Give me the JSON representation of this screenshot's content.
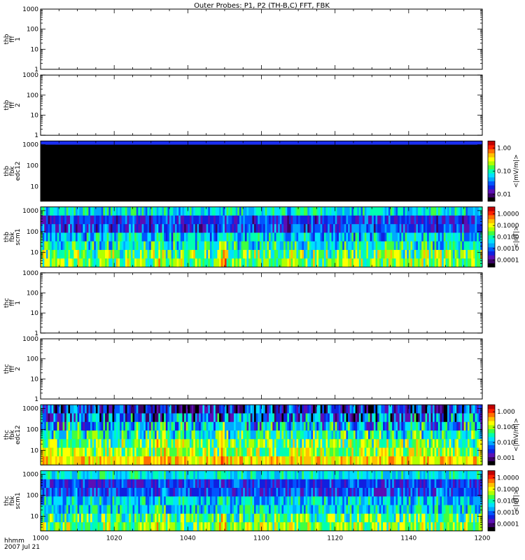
{
  "title": "Outer Probes: P1, P2 (TH-B,C) FFT, FBK",
  "time_axis": {
    "ticks": [
      "1000",
      "1020",
      "1040",
      "1100",
      "1120",
      "1140",
      "1200"
    ],
    "label_units": "hhmm",
    "label_date": "2007 Jul 21"
  },
  "palette": [
    "#000000",
    "#3b0066",
    "#5b0fb5",
    "#1020e0",
    "#0055ff",
    "#00a8ff",
    "#00e0ff",
    "#00ffb0",
    "#40ff40",
    "#b0ff00",
    "#ffff00",
    "#ffc000",
    "#ff7000",
    "#ff2000",
    "#c00000"
  ],
  "chart_data": [
    {
      "id": "thb-fff1",
      "type": "heatmap",
      "ylabel": [
        "thb",
        "fff",
        "1"
      ],
      "yscale": "log",
      "ylim": [
        1,
        1000
      ],
      "yticks": [
        "1",
        "10",
        "100",
        "1000"
      ],
      "empty": true
    },
    {
      "id": "thb-fff2",
      "type": "heatmap",
      "ylabel": [
        "thb",
        "fff",
        "2"
      ],
      "yscale": "log",
      "ylim": [
        1,
        1000
      ],
      "yticks": [
        "1",
        "10",
        "100",
        "1000"
      ],
      "empty": true
    },
    {
      "id": "thb-fbk-edc12",
      "type": "heatmap",
      "ylabel": [
        "thb",
        "fbk",
        "edc12"
      ],
      "yscale": "log",
      "ylim": [
        2,
        1500
      ],
      "yticks": [
        "10",
        "100",
        "1000"
      ],
      "pattern": "black_with_blue_top",
      "colorbar": {
        "label": "<|mV/m|>",
        "ticks": [
          "1.00",
          "0.10",
          "0.01"
        ]
      }
    },
    {
      "id": "thb-fbk-scm1",
      "type": "heatmap",
      "ylabel": [
        "thb",
        "fbk",
        "scm1"
      ],
      "yscale": "log",
      "ylim": [
        2,
        1500
      ],
      "yticks": [
        "10",
        "100",
        "1000"
      ],
      "bands": [
        {
          "base": 6.2,
          "var": 2.0
        },
        {
          "base": 3.2,
          "var": 1.8
        },
        {
          "base": 3.4,
          "var": 2.2
        },
        {
          "base": 5.6,
          "var": 2.4
        },
        {
          "base": 6.5,
          "var": 2.6
        },
        {
          "base": 8.0,
          "var": 3.0
        },
        {
          "base": 8.5,
          "var": 2.5
        }
      ],
      "colorbar": {
        "label": "<|nT|>",
        "ticks": [
          "1.0000",
          "0.1000",
          "0.0100",
          "0.0010",
          "0.0001"
        ]
      }
    },
    {
      "id": "thc-fff1",
      "type": "heatmap",
      "ylabel": [
        "thc",
        "fff",
        "1"
      ],
      "yscale": "log",
      "ylim": [
        1,
        1000
      ],
      "yticks": [
        "1",
        "10",
        "100",
        "1000"
      ],
      "empty": true
    },
    {
      "id": "thc-fff2",
      "type": "heatmap",
      "ylabel": [
        "thc",
        "fff",
        "2"
      ],
      "yscale": "log",
      "ylim": [
        1,
        1000
      ],
      "yticks": [
        "1",
        "10",
        "100",
        "1000"
      ],
      "empty": true
    },
    {
      "id": "thc-fbk-edc12",
      "type": "heatmap",
      "ylabel": [
        "thc",
        "fbk",
        "edc12"
      ],
      "yscale": "log",
      "ylim": [
        2,
        1500
      ],
      "yticks": [
        "10",
        "100",
        "1000"
      ],
      "bands": [
        {
          "base": 3.0,
          "var": 3.5
        },
        {
          "base": 3.8,
          "var": 4.0
        },
        {
          "base": 5.5,
          "var": 3.5
        },
        {
          "base": 7.0,
          "var": 3.0
        },
        {
          "base": 8.0,
          "var": 2.8
        },
        {
          "base": 8.6,
          "var": 2.5
        },
        {
          "base": 10.5,
          "var": 1.8
        }
      ],
      "colorbar": {
        "label": "<|mV/m|>",
        "ticks": [
          "1.000",
          "0.100",
          "0.010",
          "0.001"
        ]
      }
    },
    {
      "id": "thc-fbk-scm1",
      "type": "heatmap",
      "ylabel": [
        "thc",
        "fbk",
        "scm1"
      ],
      "yscale": "log",
      "ylim": [
        2,
        1500
      ],
      "yticks": [
        "10",
        "100",
        "1000"
      ],
      "bands": [
        {
          "base": 6.3,
          "var": 1.5
        },
        {
          "base": 3.3,
          "var": 1.6
        },
        {
          "base": 3.6,
          "var": 2.0
        },
        {
          "base": 5.8,
          "var": 2.2
        },
        {
          "base": 6.0,
          "var": 2.5
        },
        {
          "base": 7.5,
          "var": 2.8
        },
        {
          "base": 8.5,
          "var": 2.5
        }
      ],
      "colorbar": {
        "label": "<|nT|>",
        "ticks": [
          "1.0000",
          "0.1000",
          "0.0100",
          "0.0010",
          "0.0001"
        ]
      }
    }
  ]
}
